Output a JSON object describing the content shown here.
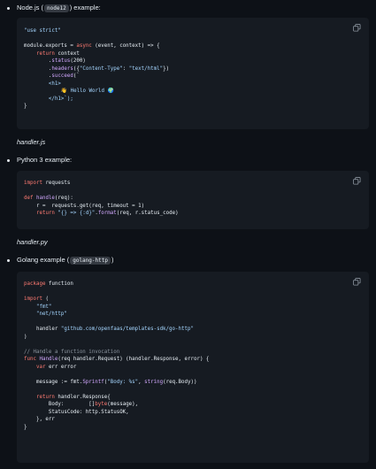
{
  "items": [
    {
      "title_before": "Node.js (",
      "badge": "node12",
      "title_after": ") example:"
    },
    {
      "title": "Python 3 example:"
    },
    {
      "title_before": "Golang example (",
      "badge": "golang-http",
      "title_after": ")"
    }
  ],
  "captions": {
    "node": "handler.js",
    "python": "handler.py"
  },
  "code": {
    "node": {
      "l1": "\"use strict\"",
      "l3a": "module.exports = ",
      "l3b": "async",
      "l3c": " (event, context) => {",
      "l4a": "    ",
      "l4b": "return",
      "l4c": " context",
      "l5a": "        .",
      "l5b": "status",
      "l5c": "(200)",
      "l6a": "        .",
      "l6b": "headers",
      "l6c": "({",
      "l6d": "\"Content-Type\"",
      "l6e": ": ",
      "l6f": "\"text/html\"",
      "l6g": "})",
      "l7a": "        .",
      "l7b": "succeed",
      "l7c": "(`",
      "l8": "        <h1>",
      "l9a": "            ",
      "l9b": "👋 Hello World 🌍",
      "l10": "        </h1>`);",
      "l11": "}"
    },
    "python": {
      "l1a": "import",
      "l1b": " requests",
      "l3a": "def",
      "l3b": " handle",
      "l3c": "(req):",
      "l4": "    r =  requests.get(req, timeout = 1)",
      "l5a": "    ",
      "l5b": "return",
      "l5c": " ",
      "l5d": "\"{} => {:d}\"",
      "l5e": ".",
      "l5f": "format",
      "l5g": "(req, r.status_code)"
    },
    "go": {
      "l1a": "package",
      "l1b": " function",
      "l3a": "import",
      "l3b": " (",
      "l4": "    \"fmt\"",
      "l5": "    \"net/http\"",
      "l7a": "    handler ",
      "l7b": "\"github.com/openfaas/templates-sdk/go-http\"",
      "l8": ")",
      "l10": "// Handle a function invocation",
      "l11a": "func",
      "l11b": " Handle",
      "l11c": "(req handler.Request) (handler.Response, error) {",
      "l12a": "    ",
      "l12b": "var",
      "l12c": " err error",
      "l14a": "    message := fmt.",
      "l14b": "Sprintf",
      "l14c": "(",
      "l14d": "\"Body: %s\"",
      "l14e": ", ",
      "l14f": "string",
      "l14g": "(req.Body))",
      "l16a": "    ",
      "l16b": "return",
      "l16c": " handler.Response{",
      "l17a": "        Body:        []",
      "l17b": "byte",
      "l17c": "(message),",
      "l18": "        StatusCode: http.StatusOK,",
      "l19": "    }, err",
      "l20": "}"
    }
  },
  "icons": {
    "copy": "copy-icon"
  },
  "colors": {
    "background": "#0d1117",
    "code_bg": "#161b22",
    "keyword": "#ff7b72",
    "function": "#d2a8ff",
    "string": "#a5d6ff",
    "comment": "#8b949e"
  }
}
